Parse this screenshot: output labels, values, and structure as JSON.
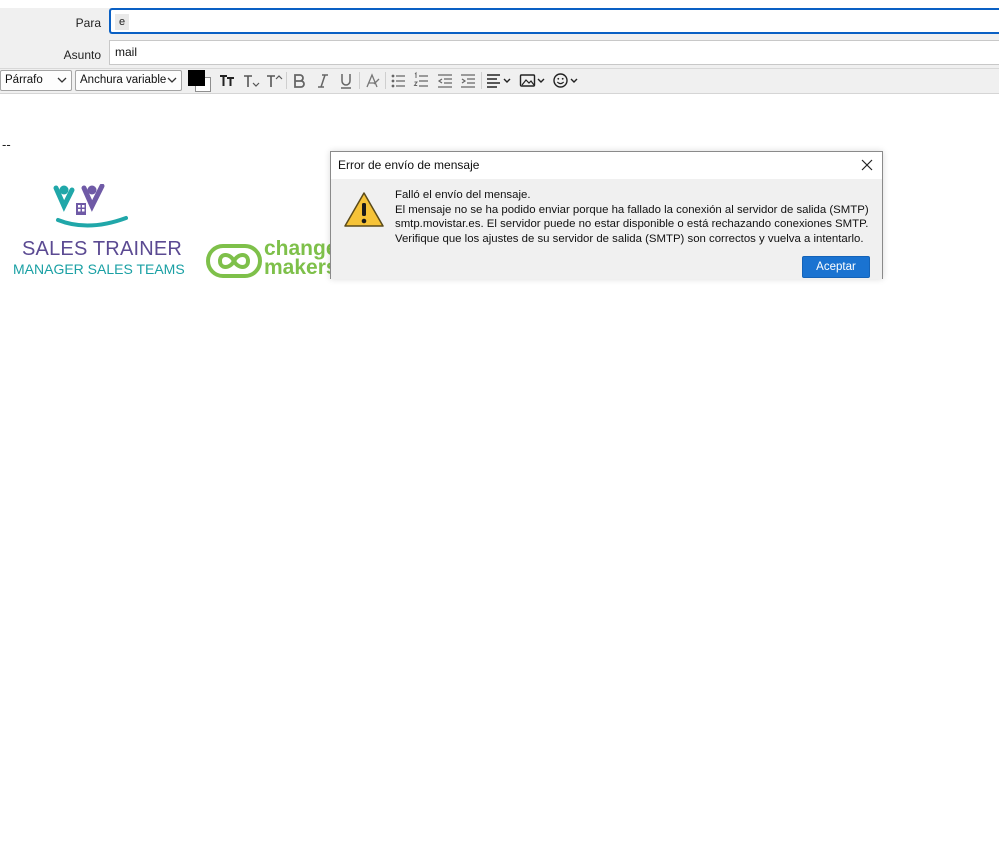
{
  "compose": {
    "to_label": "Para",
    "to_value": "e",
    "subject_label": "Asunto",
    "subject_value": "mail"
  },
  "toolbar": {
    "paragraph_format": "Párrafo",
    "font_family": "Anchura variable",
    "text_color": "#000000",
    "background_color": "#ffffff",
    "icons": [
      "text-size-icon",
      "decrease-font-icon",
      "increase-font-icon",
      "bold-icon",
      "italic-icon",
      "underline-icon",
      "clear-format-icon",
      "bullet-list-icon",
      "numbered-list-icon",
      "outdent-icon",
      "indent-icon",
      "align-icon",
      "insert-image-icon",
      "emoji-icon"
    ]
  },
  "body": {
    "signature_separator": "--",
    "logo_sales_trainer_line1": "SALES TRAINER",
    "logo_sales_trainer_line2": "MANAGER SALES TEAMS",
    "logo_changemakers_line1": "change",
    "logo_changemakers_line2": "makers"
  },
  "dialog": {
    "title": "Error de envío de mensaje",
    "message_lines": [
      "Falló el envío del mensaje.",
      "El mensaje no se ha podido enviar porque ha fallado la conexión al servidor de salida (SMTP)",
      "smtp.movistar.es. El servidor puede no estar disponible o está rechazando conexiones SMTP.",
      "Verifique que los ajustes de su servidor de salida (SMTP) son correctos y vuelva a intentarlo."
    ],
    "accept_button": "Aceptar",
    "accent_color": "#1a73d1"
  }
}
